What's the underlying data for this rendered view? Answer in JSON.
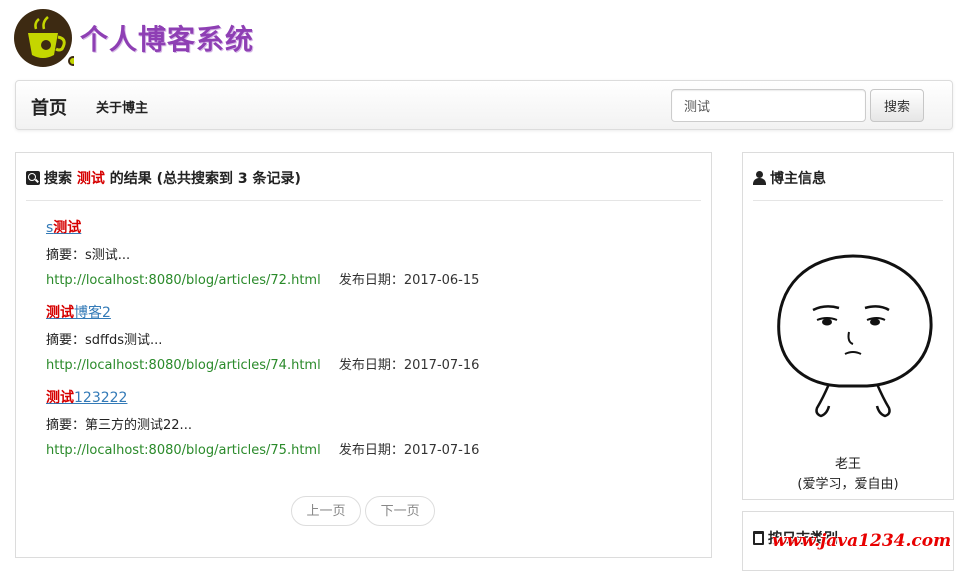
{
  "header": {
    "logo_title": "个人博客系统"
  },
  "nav": {
    "home": "首页",
    "about": "关于博主",
    "search_value": "测试",
    "search_button": "搜索"
  },
  "results": {
    "prefix": "搜索",
    "keyword": "测试",
    "suffix": "的结果",
    "count_text": "(总共搜索到 3 条记录)",
    "summary_label": "摘要：",
    "date_label": "发布日期：",
    "items": [
      {
        "title_pre": "s",
        "title_hl": "测试",
        "title_post": "",
        "summary": "s测试...",
        "url": "http://localhost:8080/blog/articles/72.html",
        "date": "2017-06-15"
      },
      {
        "title_pre": "",
        "title_hl": "测试",
        "title_post": "博客2",
        "summary": "sdffds测试...",
        "url": "http://localhost:8080/blog/articles/74.html",
        "date": "2017-07-16"
      },
      {
        "title_pre": "",
        "title_hl": "测试",
        "title_post": "123222",
        "summary": "第三方的测试22...",
        "url": "http://localhost:8080/blog/articles/75.html",
        "date": "2017-07-16"
      }
    ],
    "pager": {
      "prev": "上一页",
      "next": "下一页"
    }
  },
  "blogger": {
    "title": "博主信息",
    "name": "老王",
    "sign": "(爱学习，爱自由)"
  },
  "category": {
    "title": "按日志类别"
  },
  "watermark": "www.java1234.com",
  "colors": {
    "logo": "#8e3fb4",
    "highlight": "#d60000",
    "link": "#337ab7",
    "url": "#2a8a2a"
  }
}
